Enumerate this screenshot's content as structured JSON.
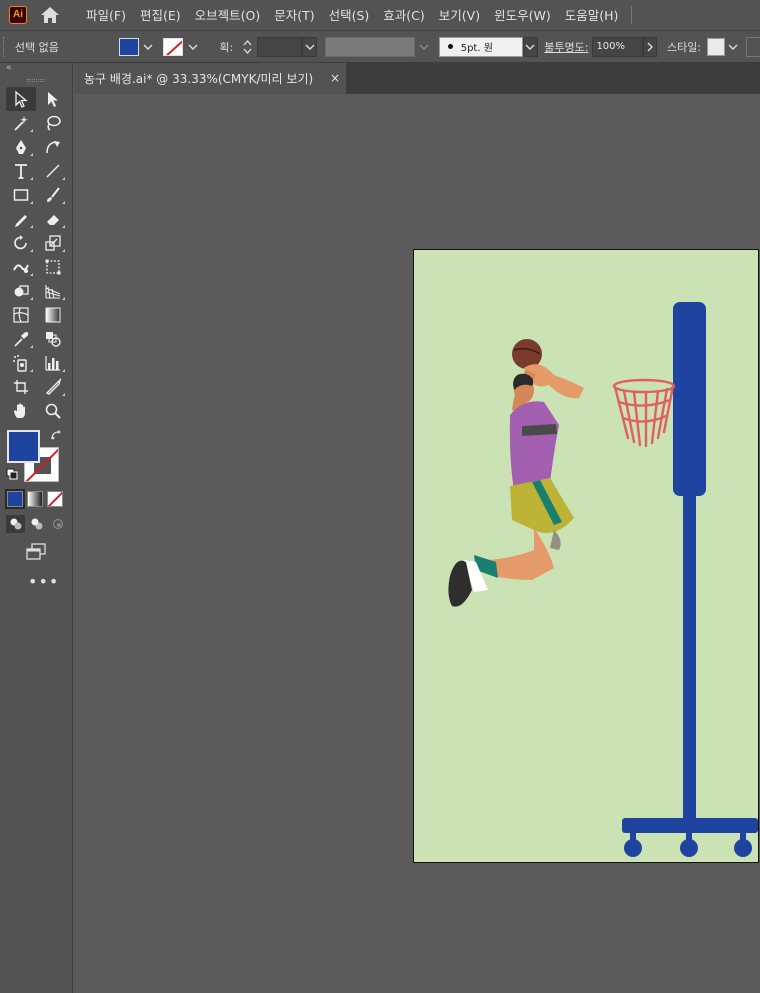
{
  "app": {
    "logo_text": "Ai",
    "menus": [
      "파일(F)",
      "편집(E)",
      "오브젝트(O)",
      "문자(T)",
      "선택(S)",
      "효과(C)",
      "보기(V)",
      "윈도우(W)",
      "도움말(H)"
    ]
  },
  "control_bar": {
    "selection_status": "선택 없음",
    "stroke_label": "획:",
    "brush_label": "5pt. 원",
    "opacity_label": "불투명도:",
    "opacity_value": "100%",
    "style_label": "스타일:",
    "fill_color": "#1f44a0"
  },
  "toolbar": {
    "collapse_label": "«",
    "more_label": "•••"
  },
  "document": {
    "tab_title": "농구 배경.ai* @ 33.33%(CMYK/미리 보기)",
    "close_label": "×"
  },
  "artwork": {
    "background_color": "#cbe2b4",
    "hoop_color": "#1f44a0",
    "net_color": "#e06060"
  }
}
